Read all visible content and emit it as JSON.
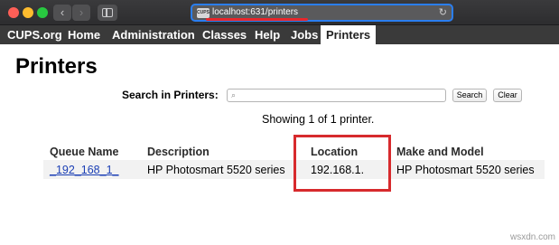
{
  "browser": {
    "url": "localhost:631/printers",
    "site_icon_text": "CUPS"
  },
  "nav": {
    "items": [
      {
        "label": "CUPS.org"
      },
      {
        "label": "Home"
      },
      {
        "label": "Administration"
      },
      {
        "label": "Classes"
      },
      {
        "label": "Help"
      },
      {
        "label": "Jobs"
      },
      {
        "label": "Printers"
      }
    ]
  },
  "page": {
    "title": "Printers"
  },
  "search": {
    "label": "Search in Printers:",
    "placeholder": "",
    "search_button": "Search",
    "clear_button": "Clear"
  },
  "summary": "Showing 1 of 1 printer.",
  "table": {
    "headers": [
      "Queue Name",
      "Description",
      "Location",
      "Make and Model"
    ],
    "rows": [
      [
        "_192_168_1_",
        "HP Photosmart 5520 series",
        "192.168.1.",
        "HP Photosmart 5520 series"
      ]
    ]
  },
  "watermark": "wsxdn.com",
  "colors": {
    "highlight": "#d72a2d",
    "link": "#1b3fb5"
  }
}
